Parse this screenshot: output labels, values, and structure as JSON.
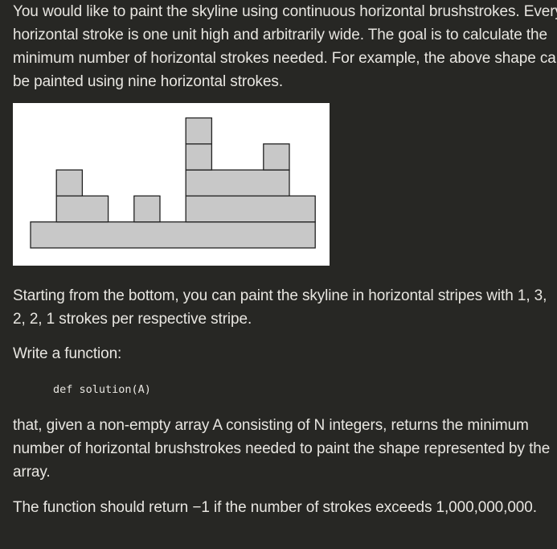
{
  "text": {
    "intro": "You would like to paint the skyline using continuous horizontal brushstrokes. Every horizontal stroke is one unit high and arbitrarily wide. The goal is to calculate the minimum number of horizontal strokes needed. For example, the above shape can be painted using nine horizontal strokes.",
    "stripes": "Starting from the bottom, you can paint the skyline in horizontal stripes with 1, 3, 2, 2, 1 strokes per respective stripe.",
    "write_function": "Write a function:",
    "code_signature": "def solution(A)",
    "description": "that, given a non-empty array A consisting of N integers, returns the minimum number of horizontal brushstrokes needed to paint the shape represented by the array.",
    "return_rule": "The function should return −1 if the number of strokes exceeds 1,000,000,000."
  },
  "figure": {
    "strokes": [
      {
        "row": 1,
        "from": 0,
        "to": 11
      },
      {
        "row": 2,
        "from": 1,
        "to": 3
      },
      {
        "row": 2,
        "from": 4,
        "to": 5
      },
      {
        "row": 2,
        "from": 6,
        "to": 11
      },
      {
        "row": 3,
        "from": 1,
        "to": 2
      },
      {
        "row": 3,
        "from": 6,
        "to": 10
      },
      {
        "row": 4,
        "from": 6,
        "to": 7
      },
      {
        "row": 4,
        "from": 9,
        "to": 10
      },
      {
        "row": 5,
        "from": 6,
        "to": 7
      }
    ],
    "fill_color": "#c8c8c8",
    "stroke_color": "#222222",
    "background_color": "#ffffff"
  },
  "colors": {
    "page_background": "#272724",
    "text": "#e8e6e1"
  }
}
